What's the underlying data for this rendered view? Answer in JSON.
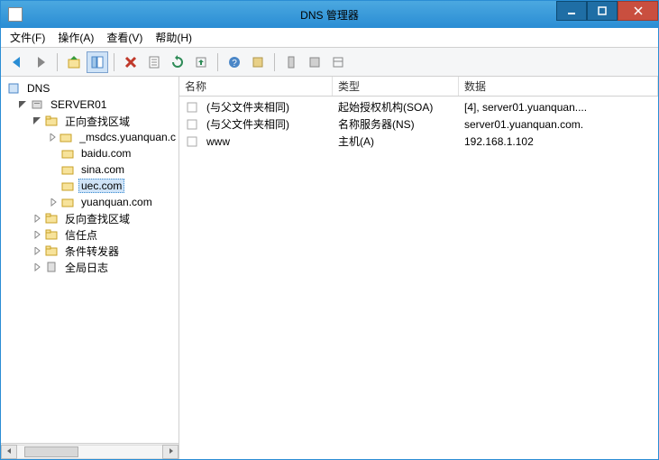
{
  "title": "DNS 管理器",
  "menu": {
    "file": "文件(F)",
    "action": "操作(A)",
    "view": "查看(V)",
    "help": "帮助(H)"
  },
  "tree": {
    "root": "DNS",
    "server": "SERVER01",
    "fwd_zone": "正向查找区域",
    "zones": {
      "z0": "_msdcs.yuanquan.c",
      "z1": "baidu.com",
      "z2": "sina.com",
      "z3": "uec.com",
      "z4": "yuanquan.com"
    },
    "rev_zone": "反向查找区域",
    "trust": "信任点",
    "cond_fwd": "条件转发器",
    "global_log": "全局日志"
  },
  "columns": {
    "name": "名称",
    "type": "类型",
    "data": "数据"
  },
  "records": [
    {
      "name": "(与父文件夹相同)",
      "type": "起始授权机构(SOA)",
      "data": "[4], server01.yuanquan...."
    },
    {
      "name": "(与父文件夹相同)",
      "type": "名称服务器(NS)",
      "data": "server01.yuanquan.com."
    },
    {
      "name": "www",
      "type": "主机(A)",
      "data": "192.168.1.102"
    }
  ]
}
